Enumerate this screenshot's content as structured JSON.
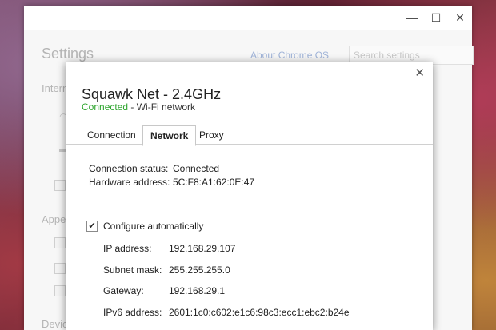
{
  "window": {
    "minimize_glyph": "—",
    "maximize_glyph": "☐",
    "close_glyph": "✕"
  },
  "settings": {
    "title": "Settings",
    "about_link": "About Chrome OS",
    "search_placeholder": "Search settings",
    "sections": {
      "internet": "Intern",
      "appearance": "Appe",
      "device": "Devic"
    }
  },
  "dialog": {
    "close_glyph": "✕",
    "title": "Squawk Net - 2.4GHz",
    "status_label": "Connected",
    "status_suffix": " - Wi-Fi network",
    "tabs": [
      {
        "label": "Connection"
      },
      {
        "label": "Network"
      },
      {
        "label": "Proxy"
      }
    ],
    "active_tab": "Network",
    "connection_status_label": "Connection status:",
    "connection_status_value": "Connected",
    "hardware_address_label": "Hardware address:",
    "hardware_address_value": "5C:F8:A1:62:0E:47",
    "configure_auto_label": "Configure automatically",
    "configure_auto_checked": true,
    "fields": [
      {
        "label": "IP address:",
        "value": "192.168.29.107"
      },
      {
        "label": "Subnet mask:",
        "value": "255.255.255.0"
      },
      {
        "label": "Gateway:",
        "value": "192.168.29.1"
      },
      {
        "label": "IPv6 address:",
        "value": "2601:1c0:c602:e1c6:98c3:ecc1:ebc2:b24e"
      }
    ]
  },
  "colors": {
    "connected_green": "#2fa62f",
    "link_blue": "#9fb3d8"
  }
}
